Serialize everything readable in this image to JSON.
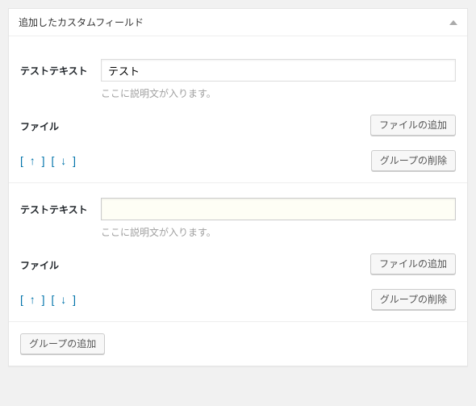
{
  "panel": {
    "title": "追加したカスタムフィールド"
  },
  "groups": [
    {
      "text_label": "テストテキスト",
      "text_value": "テスト",
      "text_desc": "ここに説明文が入ります。",
      "focused": false,
      "file_label": "ファイル",
      "file_button": "ファイルの追加",
      "arrow_up": "[ ↑ ]",
      "arrow_down": "[ ↓ ]",
      "delete_button": "グループの削除"
    },
    {
      "text_label": "テストテキスト",
      "text_value": "",
      "text_desc": "ここに説明文が入ります。",
      "focused": true,
      "file_label": "ファイル",
      "file_button": "ファイルの追加",
      "arrow_up": "[ ↑ ]",
      "arrow_down": "[ ↓ ]",
      "delete_button": "グループの削除"
    }
  ],
  "footer": {
    "add_group": "グループの追加"
  }
}
